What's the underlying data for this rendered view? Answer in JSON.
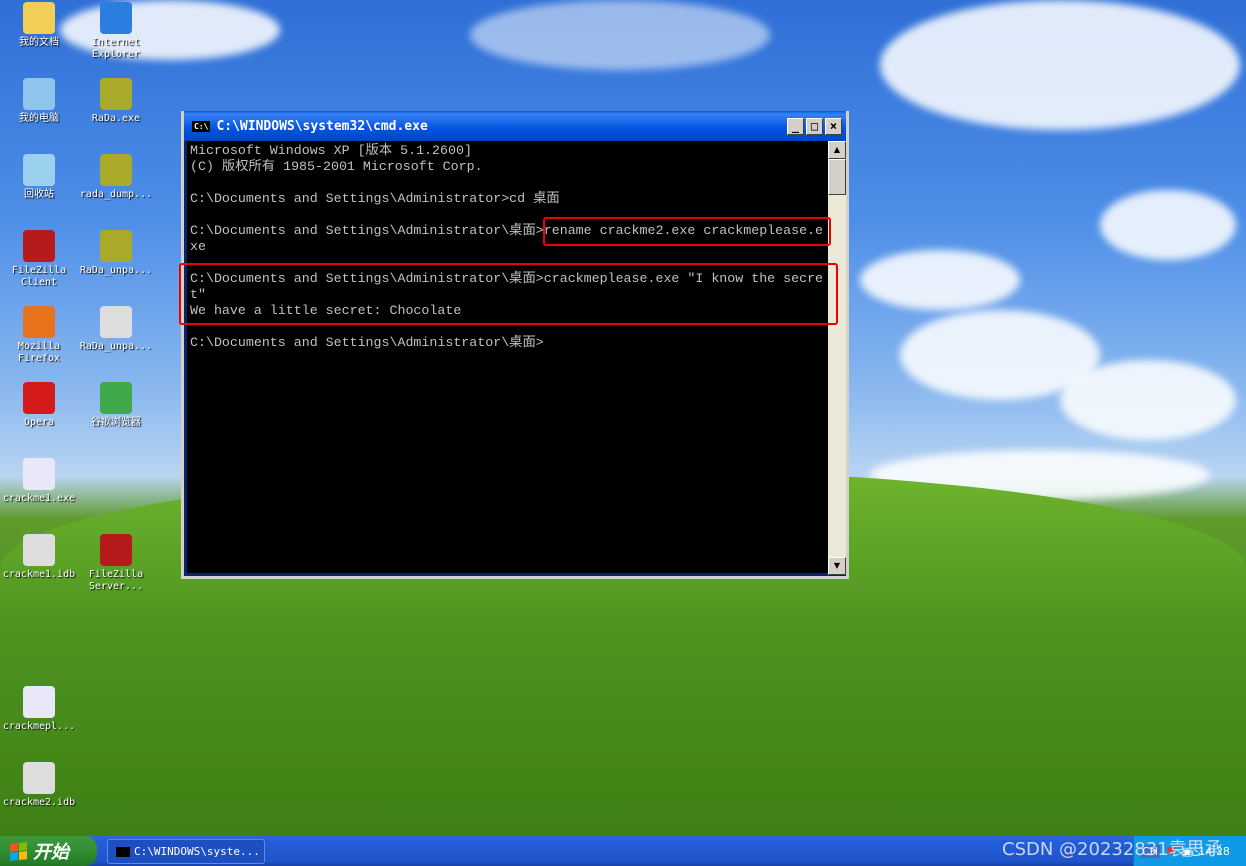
{
  "desktop": {
    "icons": [
      {
        "label": "我的文档",
        "color": "#f2cf57"
      },
      {
        "label": "Internet Explorer",
        "color": "#2b7de0"
      },
      {
        "label": "我的电脑",
        "color": "#8fc4ec"
      },
      {
        "label": "RaDa.exe",
        "color": "#a9a92a"
      },
      {
        "label": "回收站",
        "color": "#9bd0ef"
      },
      {
        "label": "rada_dump...",
        "color": "#a9a92a"
      },
      {
        "label": "FileZilla Client",
        "color": "#b51b1b"
      },
      {
        "label": "RaDa_unpa...",
        "color": "#a9a92a"
      },
      {
        "label": "Mozilla Firefox",
        "color": "#e8721c"
      },
      {
        "label": "RaDa_unpa...",
        "color": "#dddddd"
      },
      {
        "label": "Opera",
        "color": "#d41a1a"
      },
      {
        "label": "谷歌浏览器",
        "color": "#3fa84a"
      },
      {
        "label": "crackme1.exe",
        "color": "#e8e8f8"
      },
      {
        "label": "crackme1.idb",
        "color": "#dddddd"
      },
      {
        "label": "FileZilla Server...",
        "color": "#b51b1b"
      },
      {
        "label": "crackmepl...",
        "color": "#e8e8f8"
      },
      {
        "label": "crackme2.idb",
        "color": "#dddddd"
      }
    ]
  },
  "window": {
    "title": "C:\\WINDOWS\\system32\\cmd.exe",
    "icon_text": "C:\\",
    "minimize": "_",
    "maximize": "□",
    "close": "×"
  },
  "console": {
    "lines": [
      "Microsoft Windows XP [版本 5.1.2600]",
      "(C) 版权所有 1985-2001 Microsoft Corp.",
      "",
      "C:\\Documents and Settings\\Administrator>cd 桌面",
      "",
      "C:\\Documents and Settings\\Administrator\\桌面>rename crackme2.exe crackmeplease.e",
      "xe",
      "",
      "C:\\Documents and Settings\\Administrator\\桌面>crackmeplease.exe \"I know the secre",
      "t\"",
      "We have a little secret: Chocolate",
      "",
      "C:\\Documents and Settings\\Administrator\\桌面>"
    ]
  },
  "annotation_color": "#e00000",
  "taskbar": {
    "start_label": "开始",
    "task_label": "C:\\WINDOWS\\syste...",
    "ime": "CH",
    "clock": "14:28"
  },
  "watermark": "CSDN @20232831袁思承"
}
